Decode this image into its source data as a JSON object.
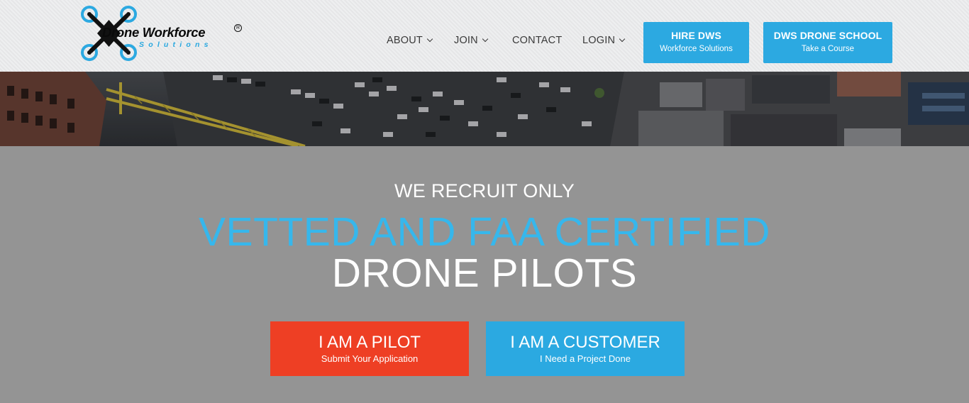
{
  "logo": {
    "name": "Drone Workforce",
    "sub": "Solutions",
    "reg": "R"
  },
  "nav": {
    "items": [
      {
        "label": "ABOUT",
        "dropdown": true
      },
      {
        "label": "JOIN",
        "dropdown": true
      },
      {
        "label": "CONTACT",
        "dropdown": false
      },
      {
        "label": "LOGIN",
        "dropdown": true
      }
    ]
  },
  "header_buttons": [
    {
      "title": "HIRE DWS",
      "subtitle": "Workforce Solutions"
    },
    {
      "title": "DWS DRONE SCHOOL",
      "subtitle": "Take a Course"
    }
  ],
  "hero": {
    "pre": "WE RECRUIT ONLY",
    "line1": "VETTED AND FAA CERTIFIED",
    "line2": "DRONE PILOTS"
  },
  "cta": {
    "pilot": {
      "title": "I AM A PILOT",
      "subtitle": "Submit Your Application"
    },
    "customer": {
      "title": "I AM A CUSTOMER",
      "subtitle": "I Need a Project Done"
    }
  },
  "colors": {
    "accent_blue": "#2ca9e1",
    "headline_blue": "#36b7ec",
    "pilot_red": "#ee3f24",
    "hero_gray": "#949494",
    "header_bg": "#e9eaeb"
  },
  "icons": [
    "drone-logo-icon",
    "chevron-down-icon"
  ]
}
